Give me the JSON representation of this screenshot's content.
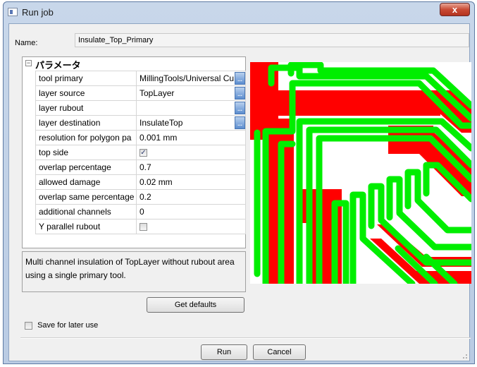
{
  "window": {
    "title": "Run job",
    "close_label": "x"
  },
  "name": {
    "label": "Name:",
    "value": "Insulate_Top_Primary"
  },
  "parameters": {
    "section_title": "パラメータ",
    "collapse_symbol": "−",
    "rows": [
      {
        "name": "tool primary",
        "value": "MillingTools/Universal Cu",
        "has_browse": true
      },
      {
        "name": "layer source",
        "value": "TopLayer",
        "has_browse": true
      },
      {
        "name": "layer rubout",
        "value": "",
        "has_browse": true
      },
      {
        "name": "layer destination",
        "value": "InsulateTop",
        "has_browse": true
      },
      {
        "name": "resolution for polygon pa",
        "value": "0.001 mm",
        "has_browse": false
      },
      {
        "name": "top side",
        "value": "",
        "checkbox": true,
        "checked": true
      },
      {
        "name": "overlap percentage",
        "value": "0.7",
        "has_browse": false
      },
      {
        "name": "allowed damage",
        "value": "0.02 mm",
        "has_browse": false
      },
      {
        "name": "overlap same percentage",
        "value": "0.2",
        "has_browse": false
      },
      {
        "name": "additional channels",
        "value": "0",
        "has_browse": false
      },
      {
        "name": "Y parallel rubout",
        "value": "",
        "checkbox": true,
        "checked": false
      }
    ],
    "browse_label": "..."
  },
  "description": "Multi channel insulation of TopLayer without rubout area using a single primary tool.",
  "buttons": {
    "get_defaults": "Get defaults",
    "run": "Run",
    "cancel": "Cancel"
  },
  "save_for_later": {
    "label": "Save for later use",
    "checked": false
  },
  "preview": {
    "copper_color": "#ff0000",
    "insulation_color": "#00ee00",
    "background_color": "#ffffff"
  }
}
